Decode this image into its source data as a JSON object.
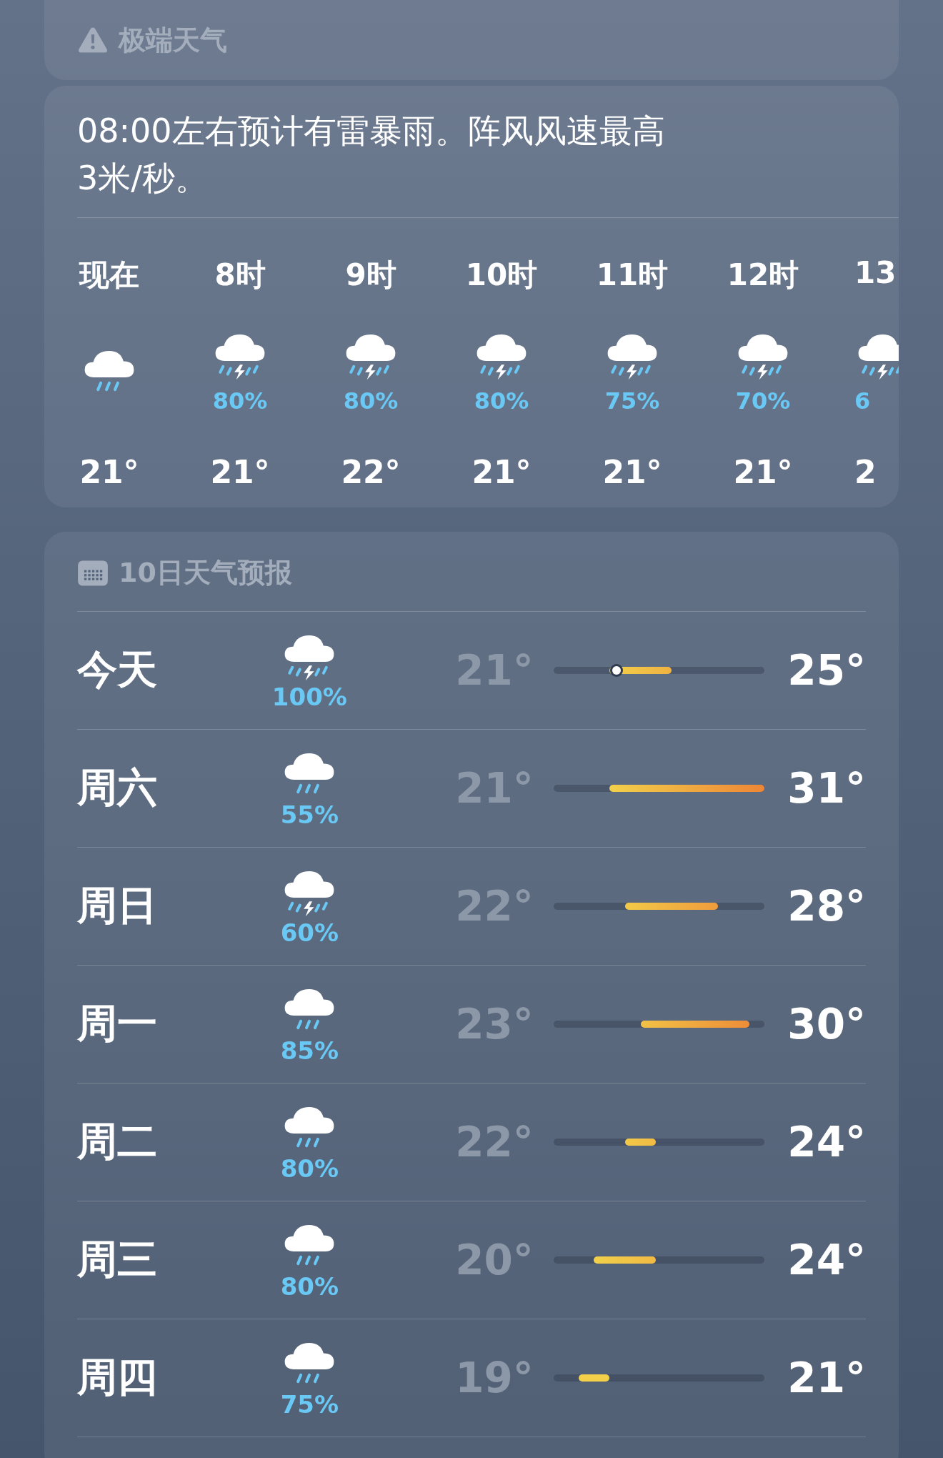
{
  "alert_card": {
    "title": "极端天气"
  },
  "summary_card": {
    "text": "08:00左右预计有雷暴雨。阵风风速最高3米/秒。",
    "hours": [
      {
        "time": "现在",
        "kind": "rain",
        "temp": "21°"
      },
      {
        "time": "8时",
        "kind": "thunderstorm",
        "chance": "80%",
        "temp": "21°"
      },
      {
        "time": "9时",
        "kind": "thunderstorm",
        "chance": "80%",
        "temp": "22°"
      },
      {
        "time": "10时",
        "kind": "thunderstorm",
        "chance": "80%",
        "temp": "21°"
      },
      {
        "time": "11时",
        "kind": "thunderstorm",
        "chance": "75%",
        "temp": "21°"
      },
      {
        "time": "12时",
        "kind": "thunderstorm",
        "chance": "70%",
        "temp": "21°"
      },
      {
        "time": "13",
        "kind": "thunderstorm",
        "chance": "6",
        "temp": "2"
      }
    ]
  },
  "forecast_card": {
    "title": "10日天气预报",
    "days": [
      {
        "day": "今天",
        "kind": "thunderstorm",
        "chance": "100%",
        "low": "21°",
        "high": "25°",
        "current_marker": true
      },
      {
        "day": "周六",
        "kind": "rain",
        "chance": "55%",
        "low": "21°",
        "high": "31°",
        "current_marker": false
      },
      {
        "day": "周日",
        "kind": "thunderstorm",
        "chance": "60%",
        "low": "22°",
        "high": "28°",
        "current_marker": false
      },
      {
        "day": "周一",
        "kind": "rain",
        "chance": "85%",
        "low": "23°",
        "high": "30°",
        "current_marker": false
      },
      {
        "day": "周二",
        "kind": "rain",
        "chance": "80%",
        "low": "22°",
        "high": "24°",
        "current_marker": false
      },
      {
        "day": "周三",
        "kind": "rain",
        "chance": "80%",
        "low": "20°",
        "high": "24°",
        "current_marker": false
      },
      {
        "day": "周四",
        "kind": "rain",
        "chance": "75%",
        "low": "19°",
        "high": "21°",
        "current_marker": false
      }
    ]
  }
}
